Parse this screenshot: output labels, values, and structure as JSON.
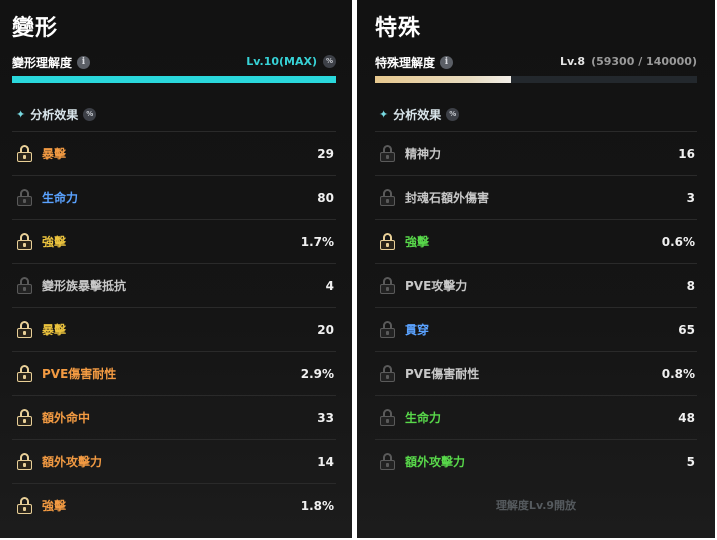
{
  "left": {
    "title": "變形",
    "proficiency_label": "變形理解度",
    "level_text": "Lv.10(MAX)",
    "level_detail": "",
    "progress_fraction": 1.0,
    "section_title": "分析效果",
    "stats": [
      {
        "name": "暴擊",
        "value": "29",
        "color": "#f29a42",
        "unlocked": true
      },
      {
        "name": "生命力",
        "value": "80",
        "color": "#5aa2ff",
        "unlocked": false
      },
      {
        "name": "強擊",
        "value": "1.7%",
        "color": "#ebc33e",
        "unlocked": true
      },
      {
        "name": "變形族暴擊抵抗",
        "value": "4",
        "color": "#c8c8c8",
        "unlocked": false
      },
      {
        "name": "暴擊",
        "value": "20",
        "color": "#ebc33e",
        "unlocked": true
      },
      {
        "name": "PVE傷害耐性",
        "value": "2.9%",
        "color": "#f29a42",
        "unlocked": true
      },
      {
        "name": "額外命中",
        "value": "33",
        "color": "#f29a42",
        "unlocked": true
      },
      {
        "name": "額外攻擊力",
        "value": "14",
        "color": "#f29a42",
        "unlocked": true
      },
      {
        "name": "強擊",
        "value": "1.8%",
        "color": "#f29a42",
        "unlocked": true
      }
    ]
  },
  "right": {
    "title": "特殊",
    "proficiency_label": "特殊理解度",
    "level_text": "Lv.8",
    "level_detail": "(59300 / 140000)",
    "progress_fraction": 0.4236,
    "section_title": "分析效果",
    "stats": [
      {
        "name": "精神力",
        "value": "16",
        "color": "#c8c8c8",
        "unlocked": false
      },
      {
        "name": "封魂石額外傷害",
        "value": "3",
        "color": "#c8c8c8",
        "unlocked": false
      },
      {
        "name": "強擊",
        "value": "0.6%",
        "color": "#58d84a",
        "unlocked": true
      },
      {
        "name": "PVE攻擊力",
        "value": "8",
        "color": "#c8c8c8",
        "unlocked": false
      },
      {
        "name": "貫穿",
        "value": "65",
        "color": "#5aa2ff",
        "unlocked": false
      },
      {
        "name": "PVE傷害耐性",
        "value": "0.8%",
        "color": "#c8c8c8",
        "unlocked": false
      },
      {
        "name": "生命力",
        "value": "48",
        "color": "#58d84a",
        "unlocked": false
      },
      {
        "name": "額外攻擊力",
        "value": "5",
        "color": "#58d84a",
        "unlocked": false
      }
    ],
    "footer_note": "理解度Lv.9開放"
  },
  "icons": {
    "info": "i",
    "percent": "%",
    "sparkle": "✦"
  }
}
